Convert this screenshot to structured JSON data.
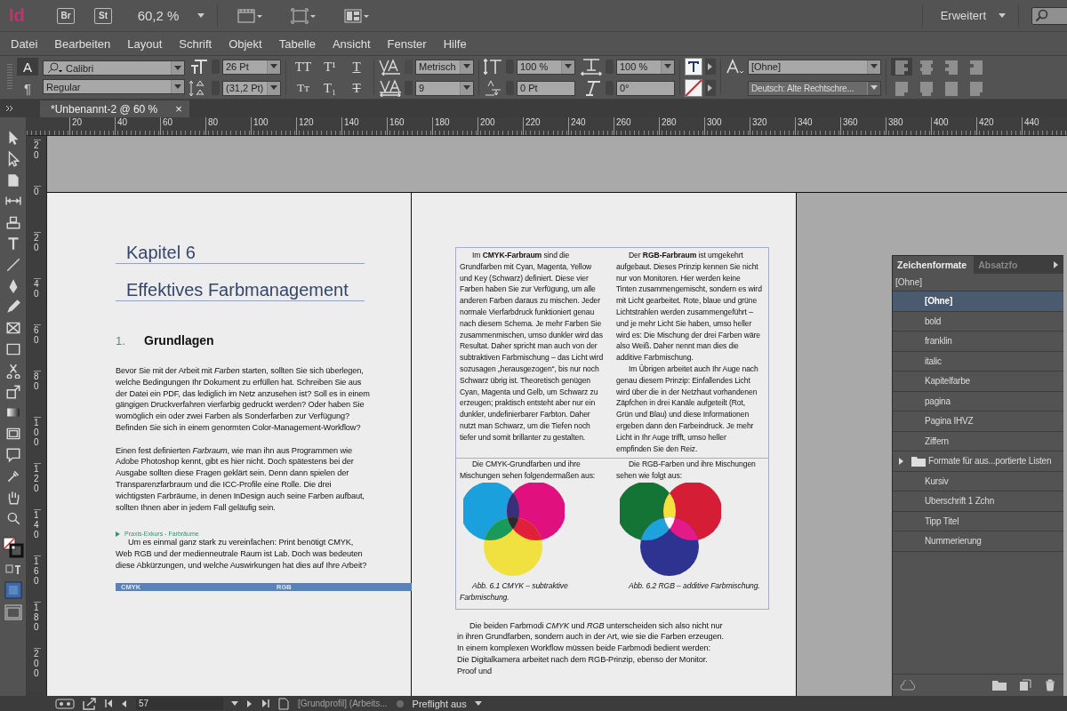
{
  "app_bar": {
    "logo": "Id",
    "bridge": "Br",
    "stock": "St",
    "zoom": "60,2 %",
    "workspace": "Erweitert"
  },
  "menu": [
    "Datei",
    "Bearbeiten",
    "Layout",
    "Schrift",
    "Objekt",
    "Tabelle",
    "Ansicht",
    "Fenster",
    "Hilfe"
  ],
  "control_panel": {
    "modes": [
      {
        "label": "A",
        "selected": true
      },
      {
        "label": "¶",
        "selected": false
      }
    ],
    "font_family": "Calibri",
    "font_style": "Regular",
    "font_size": "26 Pt",
    "leading": "(31,2 Pt)",
    "format_buttons": [
      {
        "kind": "caps",
        "label": "TT"
      },
      {
        "kind": "super",
        "label": "T¹"
      },
      {
        "kind": "underline",
        "label": "T"
      },
      {
        "kind": "smallcaps",
        "label": "Tт"
      },
      {
        "kind": "sub",
        "label": "T₁"
      },
      {
        "kind": "strike",
        "label": "T"
      }
    ],
    "kerning": "Metrisch",
    "tracking": "9",
    "vertical_scale": "100 %",
    "baseline_shift": "0 Pt",
    "horizontal_scale": "100 %",
    "skew": "0°",
    "char_style": "[Ohne]",
    "language": "Deutsch: Alte Rechtschre...",
    "align_buttons": [
      {
        "kind": "left",
        "selected": true
      },
      {
        "kind": "center",
        "selected": false
      },
      {
        "kind": "right",
        "selected": false
      },
      {
        "kind": "spine",
        "selected": false
      },
      {
        "kind": "justify-left",
        "selected": false
      },
      {
        "kind": "justify-center",
        "selected": false
      },
      {
        "kind": "justify-all",
        "selected": false
      },
      {
        "kind": "away",
        "selected": false
      }
    ]
  },
  "document_tab": {
    "title": "*Unbenannt-2 @ 60 %",
    "close": "×"
  },
  "rulers": {
    "horizontal": [
      "20",
      "40",
      "60",
      "80",
      "100",
      "120",
      "140",
      "160",
      "180",
      "200",
      "220",
      "240",
      "260",
      "280",
      "300",
      "320",
      "340",
      "360",
      "380",
      "400",
      "420",
      "440"
    ],
    "vertical": [
      "20",
      "0",
      "20",
      "40",
      "60",
      "80",
      "100",
      "120",
      "140",
      "160",
      "180",
      "200"
    ]
  },
  "left_page": {
    "chapter": "Kapitel 6",
    "title": "Effektives Farbmanagement",
    "section_number": "1.",
    "section_title": "Grundlagen",
    "paragraphs": [
      "Bevor Sie mit der Arbeit mit *Farben* starten, sollten Sie sich überlegen, welche Bedingungen Ihr Dokument zu erfüllen hat. Schreiben Sie aus der Datei ein PDF, das lediglich im Netz anzusehen ist? Soll es in einem gängigen Druckverfahren vierfarbig gedruckt werden? Oder haben Sie womöglich ein oder zwei Farben als Sonderfarben zur Verfügung? Befinden Sie sich in einem genormten Color-Management-Workflow?",
      "Einen fest definierten *Farbraum*, wie man ihn aus Programmen wie Adobe Photoshop kennt, gibt es hier nicht. Doch spätestens bei der Ausgabe sollten diese Fragen geklärt sein. Denn dann spielen der Transparenzfarbraum und die ICC-Profile eine Rolle. Die drei wichtigsten Farbräume, in denen InDesign auch seine Farben aufbaut, sollten Ihnen aber in jedem Fall geläufig sein."
    ],
    "box_label": "Praxis-Exkurs - Farbräume",
    "box_text": "Um es einmal ganz stark zu vereinfachen: Print benötigt CMYK, Web RGB und der medienneutrale Raum ist Lab. Doch was bedeuten diese Abkürzungen, und welche Auswirkungen hat dies auf Ihre Arbeit?",
    "table_header": [
      "CMYK",
      "RGB"
    ]
  },
  "right_page": {
    "columns": [
      [
        "Im **CMYK-Farbraum** sind die Grundfarben mit Cyan, Magenta, Yellow und Key (Schwarz) definiert. Diese vier Farben haben Sie zur Verfügung, um alle anderen Farben daraus zu mischen. Jeder normale Vierfarbdruck funktioniert genau nach diesem Schema. Je mehr Farben Sie zusammenmischen, umso dunkler wird das Resultat. Daher spricht man auch von der subtraktiven Farbmischung – das Licht wird sozusagen „herausgezogen“, bis nur noch Schwarz übrig ist. Theoretisch genügen Cyan, Magenta und Gelb, um Schwarz zu erzeugen; praktisch entsteht aber nur ein dunkler, undefinierbarer Farbton. Daher nutzt man Schwarz, um die Tiefen noch tiefer und somit brillanter zu gestalten."
      ],
      [
        "Der **RGB-Farbraum** ist umgekehrt aufgebaut. Dieses Prinzip kennen Sie nicht nur von Monitoren. Hier werden keine Tinten zusammengemischt, sondern es wird mit Licht gearbeitet. Rote, blaue und grüne Lichtstrahlen werden zusammengeführt – und je mehr Licht Sie haben, umso heller wird es: Die Mischung der drei Farben wäre also Weiß. Daher nennt man dies die additive Farbmischung.",
        "Im Übrigen arbeitet auch Ihr Auge nach genau diesem Prinzip: Einfallendes Licht wird über die in der Netzhaut vorhandenen Zäpfchen in drei Kanäle aufgeteilt (Rot, Grün und Blau) und diese Informationen ergeben dann den Farbeindruck. Je mehr Licht in Ihr Auge trifft, umso heller empfinden Sie den Reiz."
      ]
    ],
    "figures": [
      {
        "kind": "cmyk",
        "intro": "Die CMYK-Grundfarben und ihre Mischungen sehen folgendermaßen aus:",
        "caption": "Abb. 6.1  CMYK – subtraktive Farbmischung."
      },
      {
        "kind": "rgb",
        "intro": "Die RGB-Farben und ihre Mischungen sehen wie folgt aus:",
        "caption": "Abb. 6.2  RGB – additive Farbmischung."
      }
    ],
    "body": "Die beiden Farbmodi *CMYK* und *RGB* unterscheiden sich also nicht nur in ihren Grundfarben, sondern auch in der Art, wie sie die Farben erzeugen. In einem komplexen Workflow müssen beide Farbmodi bedient werden: Die Digitalkamera arbeitet nach dem RGB-Prinzip, ebenso der Monitor. Proof und"
  },
  "panel": {
    "tabs": [
      {
        "label": "Zeichenformate",
        "selected": true
      },
      {
        "label": "Absatzfo",
        "selected": false
      }
    ],
    "current": "[Ohne]",
    "items": [
      {
        "label": "[Ohne]",
        "kind": "style",
        "selected": true
      },
      {
        "label": "bold",
        "kind": "style",
        "selected": false
      },
      {
        "label": "franklin",
        "kind": "style",
        "selected": false
      },
      {
        "label": "italic",
        "kind": "style",
        "selected": false
      },
      {
        "label": "Kapitelfarbe",
        "kind": "style",
        "selected": false
      },
      {
        "label": "pagina",
        "kind": "style",
        "selected": false
      },
      {
        "label": "Pagina IHVZ",
        "kind": "style",
        "selected": false
      },
      {
        "label": "Ziffern",
        "kind": "style",
        "selected": false
      },
      {
        "label": "Formate für aus...portierte Listen",
        "kind": "folder",
        "selected": false
      },
      {
        "label": "Kursiv",
        "kind": "style",
        "selected": false
      },
      {
        "label": "Uberschrift 1 Zchn",
        "kind": "style",
        "selected": false
      },
      {
        "label": "Tipp Titel",
        "kind": "style",
        "selected": false
      },
      {
        "label": "Nummerierung",
        "kind": "style",
        "selected": false
      }
    ]
  },
  "status_bar": {
    "page": "57",
    "profile": "[Grundprofil] (Arbeits...",
    "preflight": "Preflight aus"
  }
}
